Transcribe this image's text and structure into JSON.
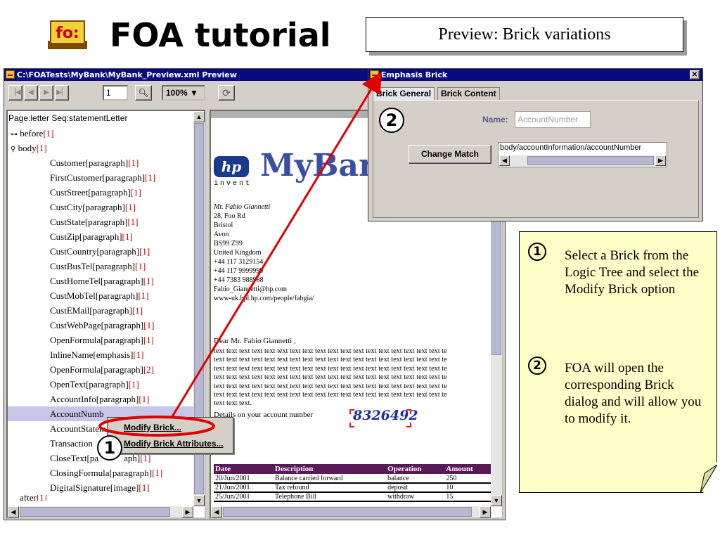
{
  "slide": {
    "title": "FOA tutorial",
    "logo_text": "fo:",
    "preview_label": "Preview: Brick variations"
  },
  "preview_window": {
    "title": "C:\\FOATests\\MyBank\\MyBank_Preview.xml Preview",
    "page": "1",
    "zoom": "100%"
  },
  "tree": {
    "rows": [
      {
        "text": "Page:letter Seq:statementLetter",
        "idx": ""
      },
      {
        "text": "before",
        "idx": "[1]"
      },
      {
        "text": "body",
        "idx": "[1]"
      },
      {
        "text": "Customer[paragraph]",
        "idx": "[1]"
      },
      {
        "text": "FirstCustomer[paragraph]",
        "idx": "[1]"
      },
      {
        "text": "CustStreet[paragraph]",
        "idx": "[1]"
      },
      {
        "text": "CustCity[paragraph]",
        "idx": "[1]"
      },
      {
        "text": "CustState[paragraph]",
        "idx": "[1]"
      },
      {
        "text": "CustZip[paragraph]",
        "idx": "[1]"
      },
      {
        "text": "CustCountry[paragraph]",
        "idx": "[1]"
      },
      {
        "text": "CustBusTel[paragraph]",
        "idx": "[1]"
      },
      {
        "text": "CustHomeTel[paragraph]",
        "idx": "[1]"
      },
      {
        "text": "CustMobTel[paragraph]",
        "idx": "[1]"
      },
      {
        "text": "CustEMail[paragraph]",
        "idx": "[1]"
      },
      {
        "text": "CustWebPage[paragraph]",
        "idx": "[1]"
      },
      {
        "text": "OpenFormula[paragraph]",
        "idx": "[1]"
      },
      {
        "text": "InlineName[emphasis]",
        "idx": "[1]"
      },
      {
        "text": "OpenFormula[paragraph]",
        "idx": "[2]"
      },
      {
        "text": "OpenText[paragraph]",
        "idx": "[1]"
      },
      {
        "text": "AccountInfo[paragraph]",
        "idx": "[1]"
      },
      {
        "text": "AccountNumb",
        "idx": ""
      },
      {
        "text": "AccountStatem",
        "idx": ""
      },
      {
        "text": "Transaction",
        "idx": ""
      },
      {
        "text": "CloseText[pa",
        "idx": ""
      },
      {
        "text": "ClosingFormula[paragraph]",
        "idx": "[1]"
      },
      {
        "text": "DigitalSignature[image]",
        "idx": "[1]"
      }
    ],
    "tail_row": {
      "text": "after",
      "idx": "[1]"
    },
    "closetext_tail": "aph]",
    "closetext_tail_idx": "[1]"
  },
  "context_menu": {
    "items": [
      "Modify Brick...",
      "Modify Brick Attributes..."
    ]
  },
  "document": {
    "logo": "hp",
    "invent": "invent",
    "bank_name": "MyBank",
    "address": [
      "Mr.  Fabio  Giannetti",
      "28, Foo Rd",
      "Bristol",
      "Avon",
      "BS99  Z99",
      "United  Kingdom",
      "+44  117  3129154",
      "+44  117  9999999",
      "+44  7383  988988",
      "Fabio_Giannetti@hp.com",
      "www-uk.hpl.hp.com/people/fabgia/"
    ],
    "salutation": "Dear  Mr. Fabio  Giannetti ,",
    "body_lines": [
      "text text text text text text text text text text text text text text text text text text te",
      "text text text text text text text text text text text text text text text text text text te",
      "text text text text text text text text text text text text text text text text text text te",
      "text text text text text text text text text text text text text text text text text text te",
      "text text text text text text text text text text text text text text text text text text te",
      "text text text text text text text text text text text text text text text text text text te",
      "text text text."
    ],
    "account_line": "Details on your account number",
    "account_number": "8326492",
    "table": {
      "headers": [
        "Date",
        "Description",
        "Operation",
        "Amount"
      ],
      "rows": [
        [
          "20/Jun/2001",
          "Balance carried forward",
          "balance",
          "250"
        ],
        [
          "21/Jun/2001",
          "Tax refound",
          "deposit",
          "10"
        ],
        [
          "25/Jun/2001",
          "Telephone Bill",
          "withdraw",
          "15"
        ]
      ]
    }
  },
  "brick_dialog": {
    "title": "Emphasis Brick",
    "tabs": [
      "Brick General",
      "Brick Content"
    ],
    "name_label": "Name:",
    "name_value": "AccountNumber",
    "change_match_label": "Change Match",
    "match_value": "body/accountInformation/accountNumber"
  },
  "note": {
    "step1": "Select a Brick from the Logic Tree and select the Modify Brick option",
    "step2": "FOA will open the corresponding Brick dialog and will allow you to modify it."
  },
  "badges": {
    "one": "1",
    "two": "2"
  },
  "colors": {
    "title_bar": "#0a0a80",
    "arrow": "#e00000",
    "note_bg": "#ffffc8",
    "tree_index": "#c00000",
    "account_number": "#1f2f9a",
    "table_header": "#5a1a5a"
  }
}
